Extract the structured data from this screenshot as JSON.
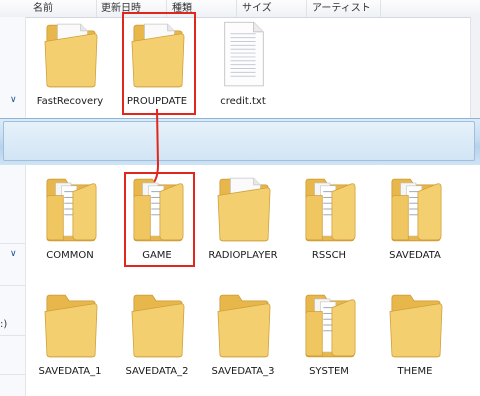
{
  "columns": [
    "名前",
    "更新日時",
    "種類",
    "サイズ",
    "アーティスト"
  ],
  "top_items": [
    {
      "name": "FastRecovery",
      "type": "folder-docs"
    },
    {
      "name": "PROUPDATE",
      "type": "folder-docs"
    },
    {
      "name": "credit.txt",
      "type": "text-file"
    }
  ],
  "bottom_items": [
    {
      "name": "COMMON",
      "type": "folder-full"
    },
    {
      "name": "GAME",
      "type": "folder-full"
    },
    {
      "name": "RADIOPLAYER",
      "type": "folder-docs"
    },
    {
      "name": "RSSCH",
      "type": "folder-full"
    },
    {
      "name": "SAVEDATA",
      "type": "folder-full"
    },
    {
      "name": "SAVEDATA_1",
      "type": "folder-empty"
    },
    {
      "name": "SAVEDATA_2",
      "type": "folder-empty"
    },
    {
      "name": "SAVEDATA_3",
      "type": "folder-empty"
    },
    {
      "name": "SYSTEM",
      "type": "folder-full"
    },
    {
      "name": "THEME",
      "type": "folder-empty"
    }
  ],
  "sidebar_fragment": ":)",
  "colors": {
    "highlight": "#e0261d",
    "folder": "#f2c764",
    "glass": "#c5dcf0"
  }
}
